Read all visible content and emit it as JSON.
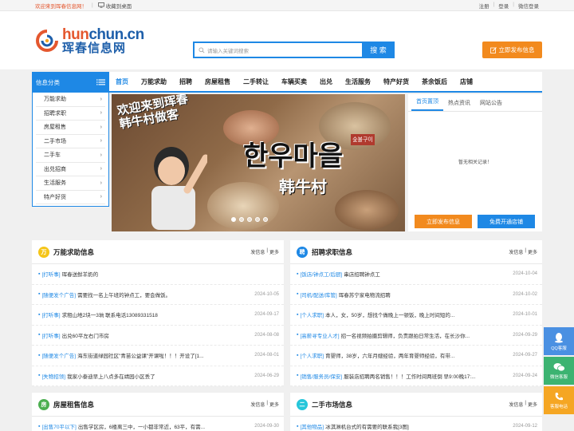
{
  "topbar": {
    "welcome": "欢迎来到珲春信息网！",
    "favorite": "收藏到桌面",
    "login_links": [
      "注册",
      "登录",
      "微信登录"
    ]
  },
  "header": {
    "logo_en_a": "hun",
    "logo_en_b": "chun",
    "logo_en_c": ".cn",
    "logo_cn": "珲春信息网",
    "search_placeholder": "请输入关键词搜索",
    "search_button": "搜 索",
    "post_button": "立即发布信息"
  },
  "nav": {
    "category_title": "信息分类",
    "items": [
      "首页",
      "万能求助",
      "招聘",
      "房屋租售",
      "二手转让",
      "车辆买卖",
      "出兑",
      "生活服务",
      "特产好货",
      "茶余饭后",
      "店铺"
    ]
  },
  "categories": [
    "万能求助",
    "招聘求职",
    "房屋租售",
    "二手市场",
    "二手车",
    "出兑招商",
    "生活服务",
    "特产好货"
  ],
  "banner": {
    "caption_line1": "欢迎来到珲春",
    "caption_line2": "韩牛村做客",
    "korean": "한우마을",
    "chinese": "韩牛村",
    "sign": "숯불구이"
  },
  "tabpanel": {
    "tabs": [
      "首页置顶",
      "热点资讯",
      "网站公告"
    ],
    "empty": "暂无相关记录！",
    "btn_post": "立即发布信息",
    "btn_shop": "免费开通店铺"
  },
  "panels": {
    "help": {
      "title": "万能求助信息",
      "more_a": "发信息",
      "more_b": "更多",
      "icon": "万",
      "color": "#f5c518",
      "rows": [
        {
          "tag": "[打听事]",
          "text": "珲春送鲜羊奶的",
          "date": ""
        },
        {
          "tag": "[随便发个广告]",
          "text": "需要找一名上午班的钟点工，要会做饭。",
          "date": "2024-10-05"
        },
        {
          "tag": "[打听事]",
          "text": "求租山地2块一3垧 联系电话13089331518",
          "date": "2024-09-17"
        },
        {
          "tag": "[打听事]",
          "text": "出兑60平左右门市房",
          "date": "2024-08-08"
        },
        {
          "tag": "[随便发个广告]",
          "text": "海东街道绿园社区\"青苗公益课\"开课啦！！！开设了[1...",
          "date": "2024-08-01"
        },
        {
          "tag": "[失物招领]",
          "text": "我家小泰迪早上八点多在靖园小区丢了",
          "date": "2024-06-29"
        }
      ]
    },
    "jobs": {
      "title": "招聘求职信息",
      "more_a": "发信息",
      "more_b": "更多",
      "icon": "聘",
      "color": "#1e88e5",
      "rows": [
        {
          "tag": "[饭店/钟点工/后厨]",
          "text": "串店招聘钟点工",
          "date": "2024-10-04"
        },
        {
          "tag": "[司机/配送/库管]",
          "text": "珲春苏宁家电物流招聘",
          "date": "2024-10-02"
        },
        {
          "tag": "[个人求职]",
          "text": "本人，女，50岁，想找个做晚上一顿饭，晚上时间短的...",
          "date": "2024-10-01"
        },
        {
          "tag": "[高薪寻专业人才]",
          "text": "招一名视频拍摄剪辑师，负责跟拍日常生活，在长沙你...",
          "date": "2024-09-29"
        },
        {
          "tag": "[个人求职]",
          "text": "育婴师，38岁，六年月嫂经验，两年育婴师经验，有带...",
          "date": "2024-09-27"
        },
        {
          "tag": "[销售/服务员/保安]",
          "text": "服装店招聘两名销售！！！工作时间两班倒 早9:00晚17:...",
          "date": "2024-09-24"
        }
      ]
    },
    "house": {
      "title": "房屋租售信息",
      "more_a": "发信息",
      "more_b": "更多",
      "icon": "房",
      "color": "#4caf50",
      "rows": [
        {
          "tag": "[出售70平以下]",
          "text": "出售学区房，6楼离三中，一小都非常近，63平，有需...",
          "date": "2024-09-30"
        }
      ]
    },
    "market": {
      "title": "二手市场信息",
      "more_a": "发信息",
      "more_b": "更多",
      "icon": "二",
      "color": "#26c6da",
      "rows": [
        {
          "tag": "[其他物品]",
          "text": "冰淇淋机台式的有需要的联系我[3图]",
          "date": "2024-09-12"
        }
      ]
    }
  },
  "float": {
    "qq": "QQ客服",
    "wechat": "微信客服",
    "phone": "客服电话"
  }
}
